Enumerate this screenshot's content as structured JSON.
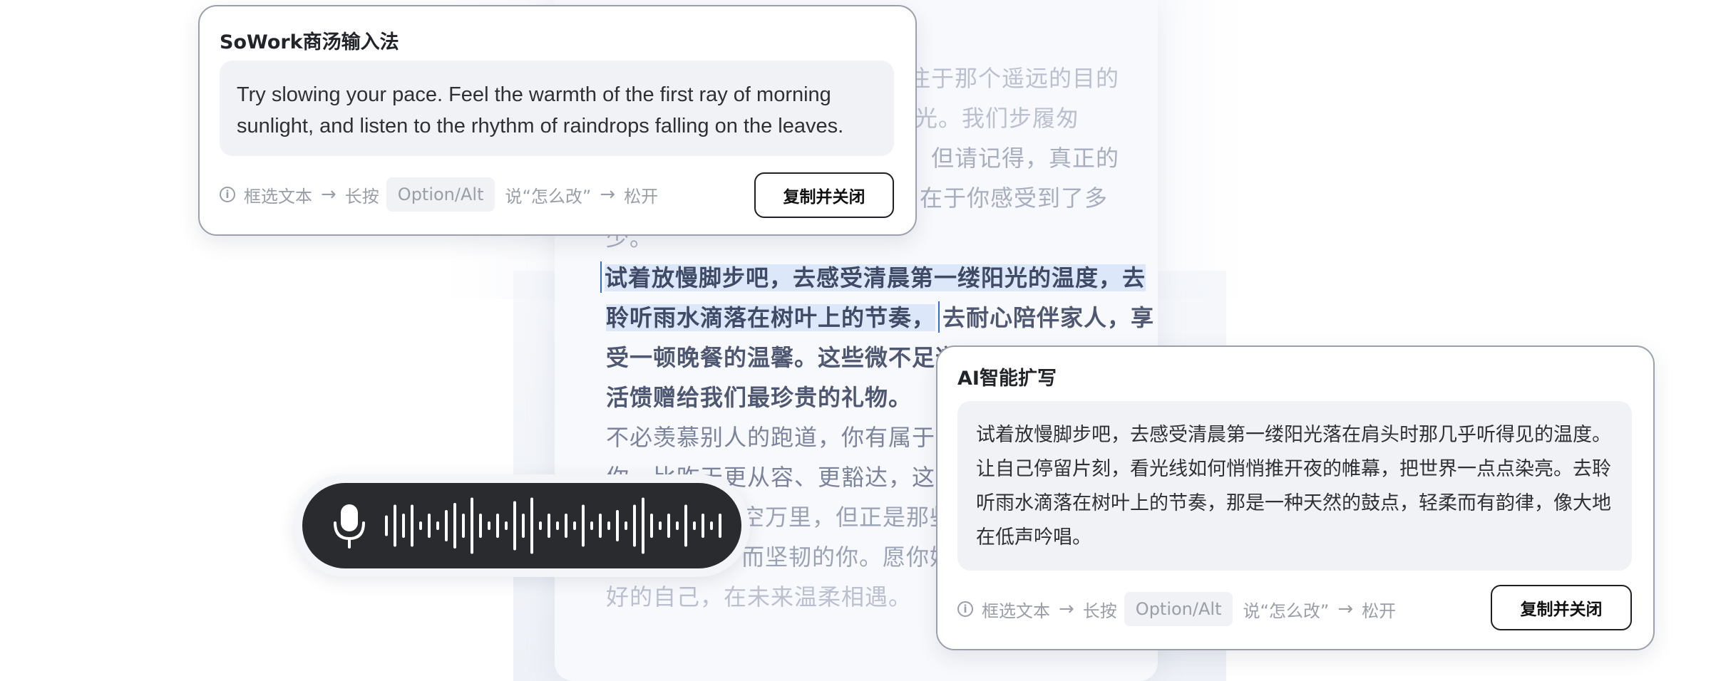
{
  "document": {
    "line1": "注于那个遥远的目的",
    "line2": "星光。我们步履匆",
    "line3": "。但请记得，真正的",
    "line4": "在于你感受到了多",
    "line5": "少。",
    "line6": "试着放慢脚步吧，去感受清晨第一缕阳光的温度，去",
    "line7_selected": "聆听雨水滴落在树叶上的节奏，",
    "line7_rest": "去耐心陪伴家人，享",
    "line8": "受一顿晚餐的温馨。这些微不足道",
    "line9": "活馈赠给我们最珍贵的礼物。",
    "line10": "不必羡慕别人的跑道，你有属于自",
    "line11": "你，比昨天更从容、更豁达，这就",
    "line12": "空万里，但正是那些",
    "line13": "而坚韧的你。愿你始",
    "line14": "好的自己，在未来温柔相遇。"
  },
  "card1": {
    "title": "SoWork商汤输入法",
    "body": "Try slowing your pace. Feel the warmth of the first ray of morning sunlight, and listen to the rhythm of raindrops falling on the leaves.",
    "hint_select": "框选文本",
    "hint_hold": "长按",
    "hint_key": "Option/Alt",
    "hint_say": "说“怎么改”",
    "hint_release": "松开",
    "button": "复制并关闭"
  },
  "card2": {
    "title": "AI智能扩写",
    "body": "试着放慢脚步吧，去感受清晨第一缕阳光落在肩头时那几乎听得见的温度。让自己停留片刻，看光线如何悄悄推开夜的帷幕，把世界一点点染亮。去聆听雨水滴落在树叶上的节奏，那是一种天然的鼓点，轻柔而有韵律，像大地在低声吟唱。",
    "hint_select": "框选文本",
    "hint_hold": "长按",
    "hint_key": "Option/Alt",
    "hint_say": "说“怎么改”",
    "hint_release": "松开",
    "button": "复制并关闭"
  },
  "voice": {
    "icon": "microphone-icon",
    "wave_heights": [
      0.25,
      0.55,
      0.3,
      0.55,
      0.08,
      0.3,
      0.08,
      0.4,
      0.6,
      0.3,
      0.75,
      0.3,
      0.08,
      0.3,
      0.08,
      0.65,
      0.3,
      0.75,
      0.08,
      0.3,
      0.08,
      0.3,
      0.08,
      0.55,
      0.08,
      0.3,
      0.08,
      0.4,
      0.08,
      0.55,
      0.75,
      0.3,
      0.08,
      0.3,
      0.08,
      0.55,
      0.08,
      0.3,
      0.08,
      0.3
    ]
  },
  "colors": {
    "accent_caret": "#2d6fe6",
    "selection": "#dde7fa",
    "voice_bar": "#2a2b2e"
  }
}
